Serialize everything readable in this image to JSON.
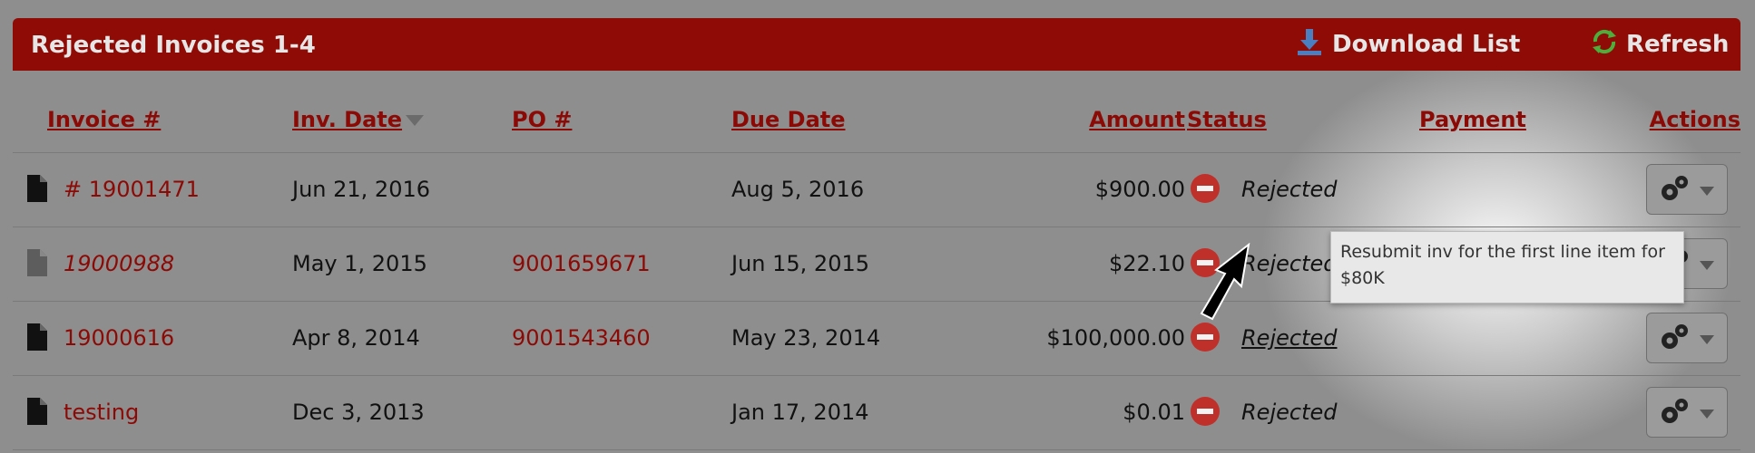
{
  "header": {
    "title": "Rejected Invoices 1-4",
    "download_label": "Download List",
    "refresh_label": "Refresh"
  },
  "columns": {
    "invoice": "Invoice #",
    "inv_date": "Inv. Date",
    "po": "PO #",
    "due_date": "Due Date",
    "amount": "Amount",
    "status": "Status",
    "payment": "Payment",
    "actions": "Actions"
  },
  "rows": [
    {
      "invoice": "# 19001471",
      "inv_date": "Jun 21, 2016",
      "po": "",
      "due_date": "Aug 5, 2016",
      "amount": "$900.00",
      "status": "Rejected"
    },
    {
      "invoice": "19000988",
      "inv_date": "May 1, 2015",
      "po": "9001659671",
      "due_date": "Jun 15, 2015",
      "amount": "$22.10",
      "status": "Rejected"
    },
    {
      "invoice": "19000616",
      "inv_date": "Apr 8, 2014",
      "po": "9001543460",
      "due_date": "May 23, 2014",
      "amount": "$100,000.00",
      "status": "Rejected"
    },
    {
      "invoice": "testing",
      "inv_date": "Dec 3, 2013",
      "po": "",
      "due_date": "Jan 17, 2014",
      "amount": "$0.01",
      "status": "Rejected"
    }
  ],
  "tooltip": {
    "text": "Resubmit inv for the first line item for $80K"
  },
  "icons": {
    "download": "download-icon",
    "refresh": "refresh-icon",
    "document": "document-icon",
    "status": "rejected-icon",
    "actions": "gear-icon"
  },
  "colors": {
    "header_bg": "#8f0b06",
    "link": "#8c0a06",
    "rejected": "#c0302b"
  }
}
